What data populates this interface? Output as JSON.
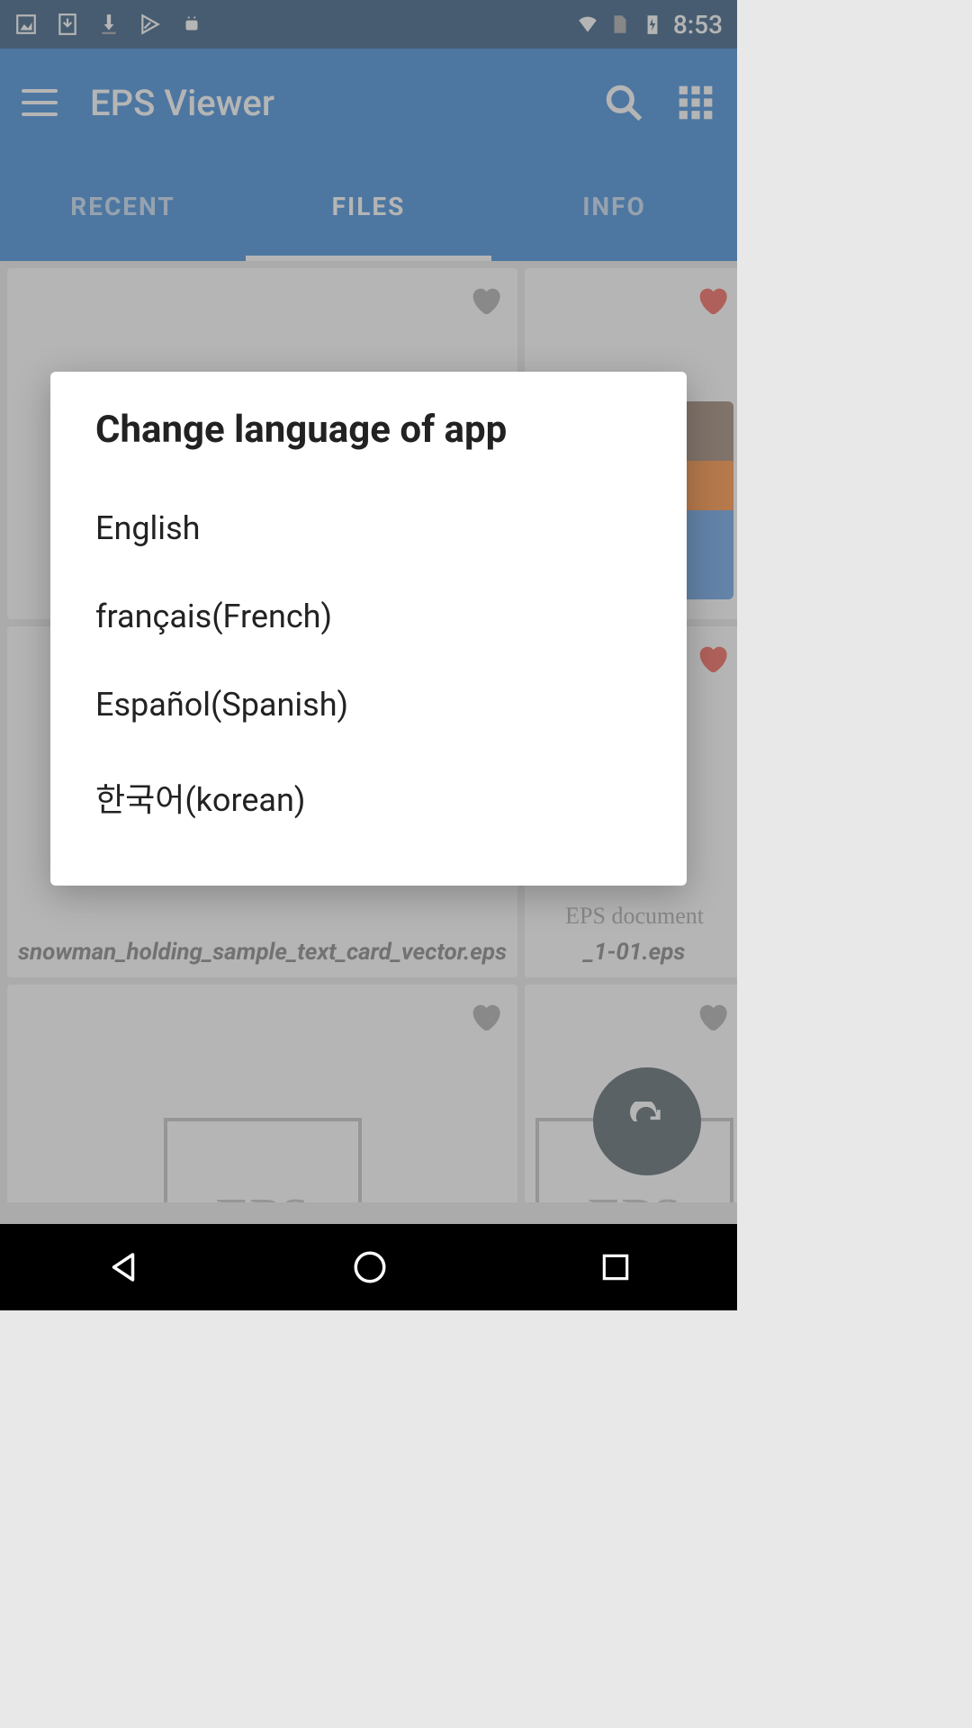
{
  "status_bar": {
    "time": "8:53"
  },
  "app_bar": {
    "title": "EPS Viewer"
  },
  "tabs": {
    "recent": "RECENT",
    "files": "FILES",
    "info": "INFO",
    "active": "files"
  },
  "files": {
    "item0": {
      "label": "",
      "favorite": false
    },
    "item1": {
      "label": "",
      "favorite": true
    },
    "item2": {
      "label": "snowman_holding_sample_text_card_vector.eps",
      "favorite": false
    },
    "item3": {
      "label": "_1-01.eps",
      "favorite": true,
      "subtitle": "EPS document"
    },
    "item4": {
      "label": "",
      "favorite": false
    },
    "item5": {
      "label": "",
      "favorite": false
    }
  },
  "dialog": {
    "title": "Change language of app",
    "options": {
      "english": "English",
      "french": "français(French)",
      "spanish": "Español(Spanish)",
      "korean": "한국어(korean)"
    }
  }
}
